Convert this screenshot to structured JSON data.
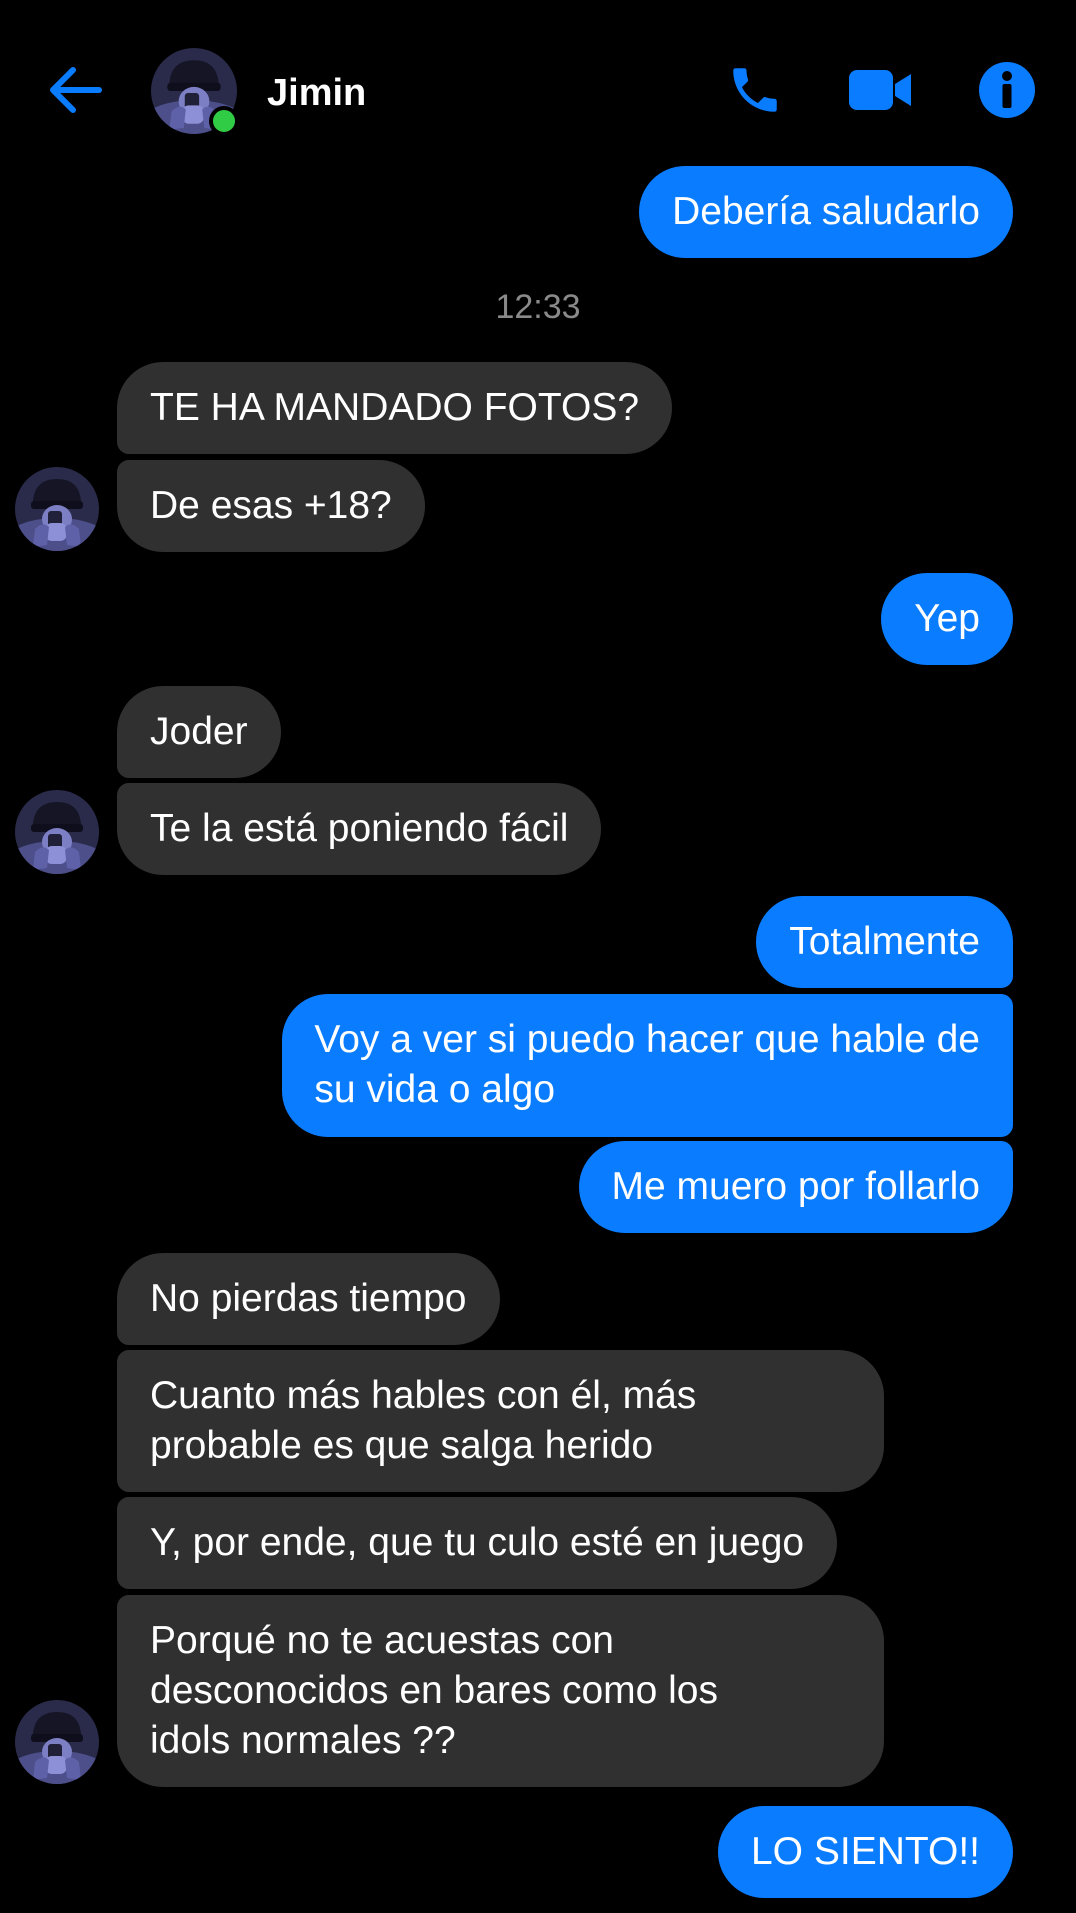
{
  "header": {
    "contact_name": "Jimin",
    "status": "online",
    "icons": {
      "back": "arrow-left-icon",
      "phone": "phone-icon",
      "video": "video-camera-icon",
      "info": "info-icon"
    }
  },
  "colors": {
    "accent": "#0a7cff",
    "incoming_bubble": "#303030",
    "background": "#000000",
    "online": "#31cc46",
    "timestamp": "#8a8a8a"
  },
  "conversation": {
    "timestamp": "12:33",
    "messages": [
      {
        "direction": "outgoing",
        "text": "Debería saludarlo"
      },
      {
        "direction": "incoming",
        "text": "TE HA MANDADO FOTOS?"
      },
      {
        "direction": "incoming",
        "text": "De esas +18?"
      },
      {
        "direction": "outgoing",
        "text": "Yep"
      },
      {
        "direction": "incoming",
        "text": "Joder"
      },
      {
        "direction": "incoming",
        "text": "Te la está poniendo fácil"
      },
      {
        "direction": "outgoing",
        "text": "Totalmente"
      },
      {
        "direction": "outgoing",
        "text": "Voy a ver si puedo hacer que hable de\nsu vida o algo"
      },
      {
        "direction": "outgoing",
        "text": "Me muero por follarlo"
      },
      {
        "direction": "incoming",
        "text": "No pierdas tiempo"
      },
      {
        "direction": "incoming",
        "text": "Cuanto más hables con él, más\nprobable es que salga herido"
      },
      {
        "direction": "incoming",
        "text": "Y, por ende, que tu culo esté en juego"
      },
      {
        "direction": "incoming",
        "text": "Porqué no te acuestas con\ndesconocidos en bares como los\nidols normales ??"
      },
      {
        "direction": "outgoing",
        "text": "LO SIENTO!!"
      }
    ]
  }
}
